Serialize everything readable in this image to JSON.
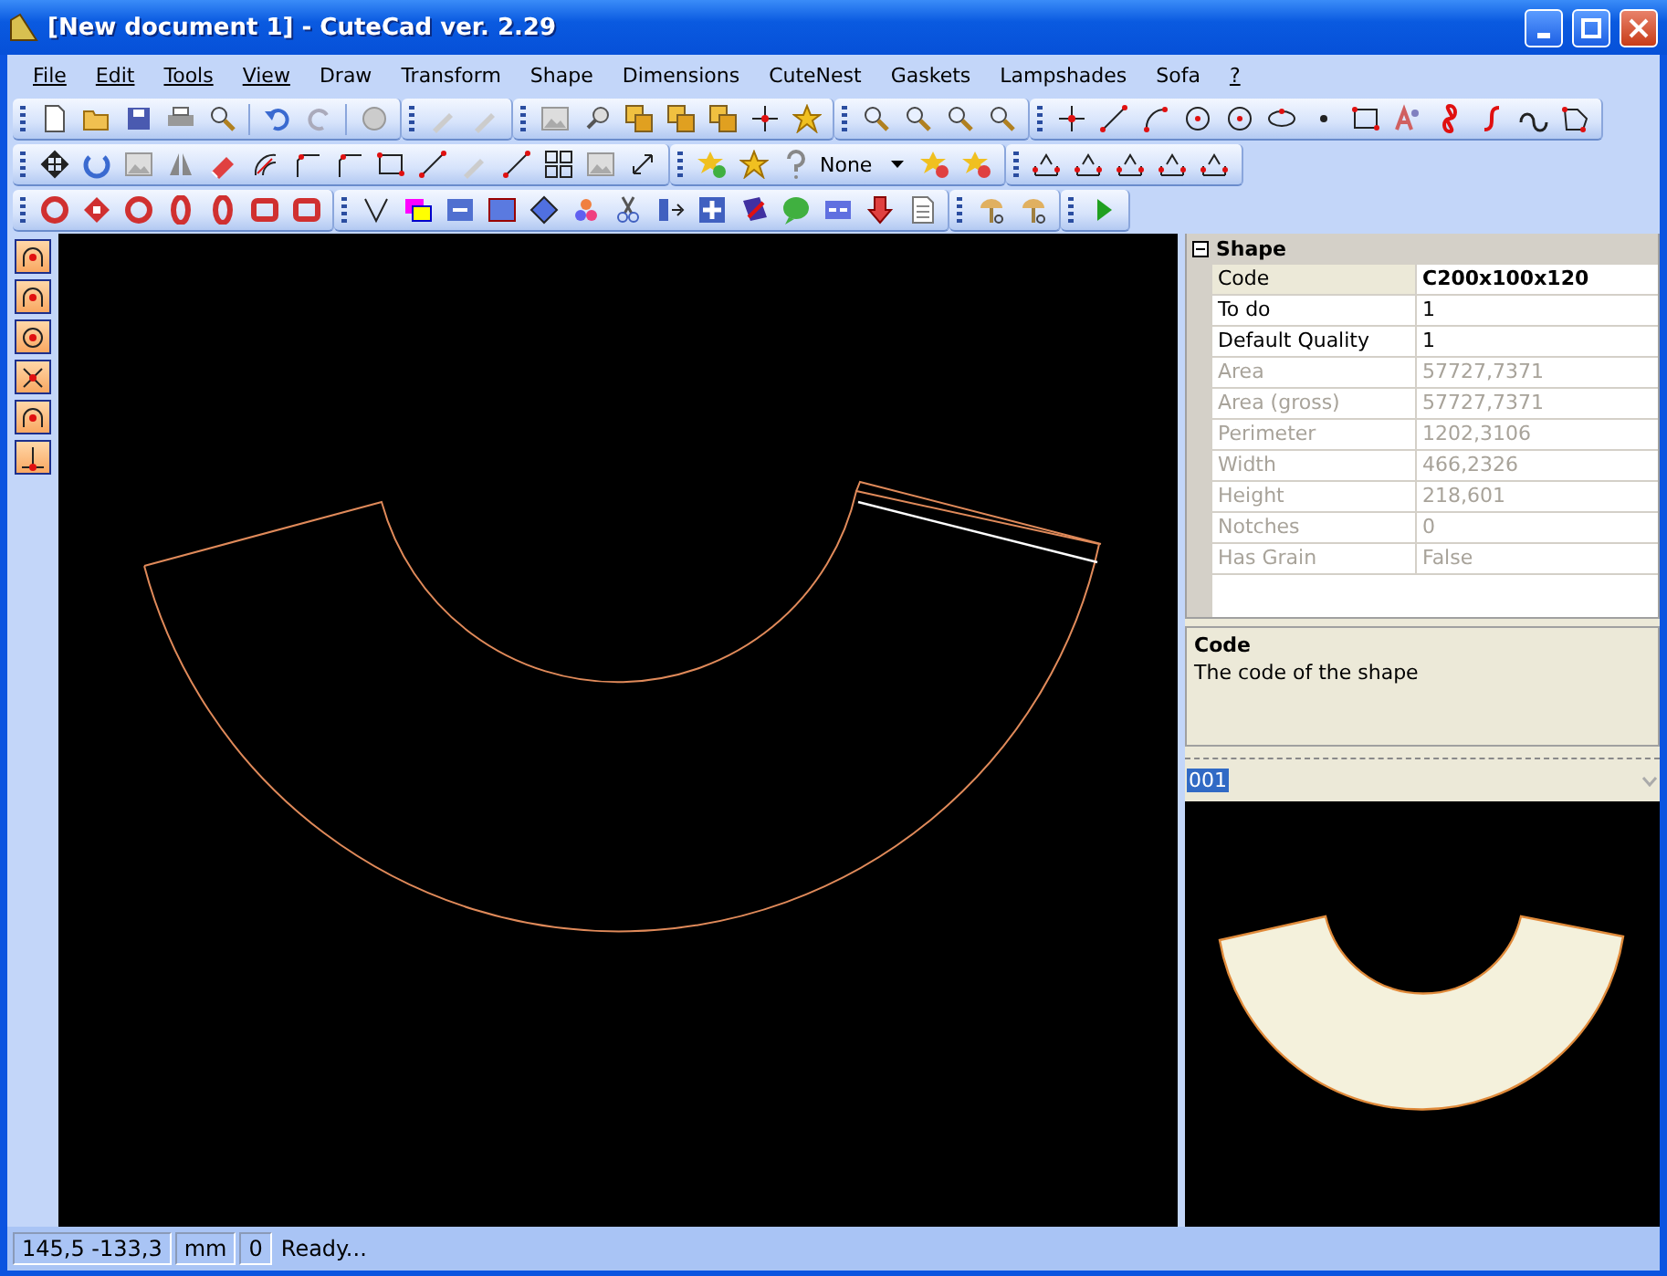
{
  "window": {
    "title": "[New document 1] - CuteCad ver. 2.29"
  },
  "menu": [
    {
      "label": "File",
      "underlined": true
    },
    {
      "label": "Edit",
      "underlined": true
    },
    {
      "label": "Tools",
      "underlined": true
    },
    {
      "label": "View",
      "underlined": true
    },
    {
      "label": "Draw",
      "underlined": false
    },
    {
      "label": "Transform",
      "underlined": false
    },
    {
      "label": "Shape",
      "underlined": false
    },
    {
      "label": "Dimensions",
      "underlined": false
    },
    {
      "label": "CuteNest",
      "underlined": false
    },
    {
      "label": "Gaskets",
      "underlined": false
    },
    {
      "label": "Lampshades",
      "underlined": false
    },
    {
      "label": "Sofa",
      "underlined": false
    },
    {
      "label": "?",
      "underlined": true
    }
  ],
  "toolbar_dropdown": {
    "value": "None"
  },
  "properties": {
    "category": "Shape",
    "expanded": true,
    "rows": [
      {
        "name": "Code",
        "value": "C200x100x120",
        "selected": true,
        "disabled": false
      },
      {
        "name": "To do",
        "value": "1",
        "selected": false,
        "disabled": false
      },
      {
        "name": "Default Quality",
        "value": "1",
        "selected": false,
        "disabled": false
      },
      {
        "name": "Area",
        "value": "57727,7371",
        "selected": false,
        "disabled": true
      },
      {
        "name": "Area (gross)",
        "value": "57727,7371",
        "selected": false,
        "disabled": true
      },
      {
        "name": "Perimeter",
        "value": "1202,3106",
        "selected": false,
        "disabled": true
      },
      {
        "name": "Width",
        "value": "466,2326",
        "selected": false,
        "disabled": true
      },
      {
        "name": "Height",
        "value": "218,601",
        "selected": false,
        "disabled": true
      },
      {
        "name": "Notches",
        "value": "0",
        "selected": false,
        "disabled": true
      },
      {
        "name": "Has Grain",
        "value": "False",
        "selected": false,
        "disabled": true
      }
    ]
  },
  "description": {
    "title": "Code",
    "text": "The code of the shape"
  },
  "piece_select": {
    "value": "001"
  },
  "status_bar": {
    "coordinates": "145,5 -133,3",
    "unit": "mm",
    "count": "0",
    "message": "Ready..."
  }
}
